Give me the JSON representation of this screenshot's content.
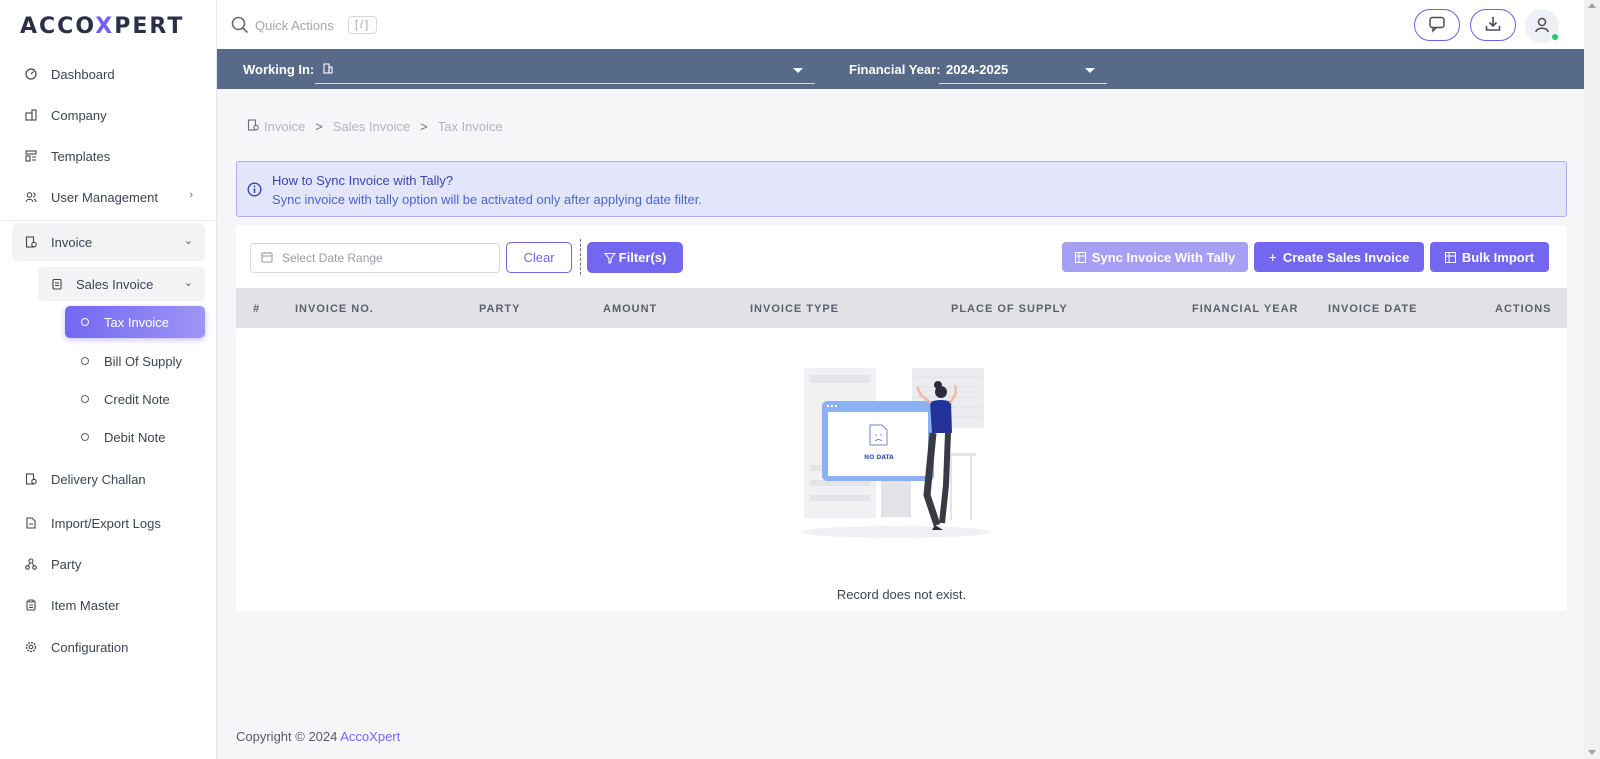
{
  "app": {
    "logo_text_1": "ACCO",
    "logo_text_2": "X",
    "logo_text_3": "PERT"
  },
  "sidebar": {
    "items": [
      {
        "label": "Dashboard",
        "icon": "dashboard-icon"
      },
      {
        "label": "Company",
        "icon": "company-icon"
      },
      {
        "label": "Templates",
        "icon": "templates-icon"
      },
      {
        "label": "User Management",
        "icon": "users-icon"
      },
      {
        "label": "Invoice",
        "icon": "invoice-icon"
      },
      {
        "label": "Delivery Challan",
        "icon": "delivery-icon"
      },
      {
        "label": "Import/Export Logs",
        "icon": "logs-icon"
      },
      {
        "label": "Party",
        "icon": "party-icon"
      },
      {
        "label": "Item Master",
        "icon": "item-icon"
      },
      {
        "label": "Configuration",
        "icon": "settings-icon"
      }
    ],
    "sub": {
      "label": "Sales Invoice"
    },
    "leaves": [
      {
        "label": "Tax Invoice"
      },
      {
        "label": "Bill Of Supply"
      },
      {
        "label": "Credit Note"
      },
      {
        "label": "Debit Note"
      }
    ]
  },
  "topbar": {
    "search_placeholder": "Quick Actions",
    "shortcut": "[/]"
  },
  "strip": {
    "working_in_label": "Working In:",
    "working_in_value": "",
    "fy_label": "Financial Year:",
    "fy_value": "2024-2025"
  },
  "breadcrumb": {
    "c1": "Invoice",
    "c2": "Sales Invoice",
    "c3": "Tax Invoice",
    "sep": ">"
  },
  "info": {
    "title": "How to Sync Invoice with Tally?",
    "text": "Sync invoice with tally option will be activated only after applying date filter."
  },
  "toolbar": {
    "date_placeholder": "Select Date Range",
    "clear": "Clear",
    "filter": "Filter(s)",
    "sync": "Sync Invoice With Tally",
    "create": "Create Sales Invoice",
    "bulk": "Bulk Import"
  },
  "table": {
    "headers": [
      "#",
      "INVOICE NO.",
      "PARTY",
      "AMOUNT",
      "INVOICE TYPE",
      "PLACE OF SUPPLY",
      "FINANCIAL YEAR",
      "INVOICE DATE",
      "ACTIONS"
    ],
    "empty_message": "Record does not exist.",
    "illustration_text": "NO DATA"
  },
  "footer": {
    "copyright": "Copyright © 2024",
    "brand": "AccoXpert"
  },
  "colors": {
    "accent": "#7367f0",
    "strip": "#586a89",
    "info_bg": "#e3e5fb"
  }
}
